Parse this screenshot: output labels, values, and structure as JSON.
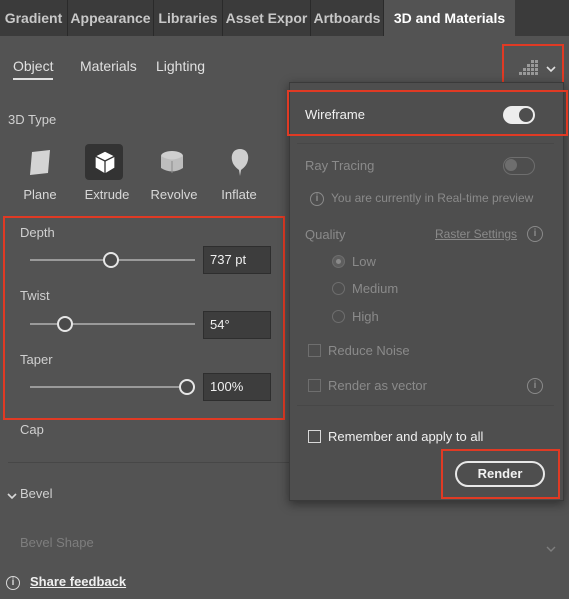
{
  "tabs": [
    "Gradient",
    "Appearance",
    "Libraries",
    "Asset Expor",
    "Artboards",
    "3D and Materials"
  ],
  "subtabs": [
    "Object",
    "Materials",
    "Lighting"
  ],
  "section_3d_type": "3D Type",
  "types": [
    "Plane",
    "Extrude",
    "Revolve",
    "Inflate"
  ],
  "depth": {
    "label": "Depth",
    "value": "737 pt",
    "level": 0.49
  },
  "twist": {
    "label": "Twist",
    "value": "54°",
    "level": 0.18
  },
  "taper": {
    "label": "Taper",
    "value": "100%",
    "level": 1.0
  },
  "cap_label": "Cap",
  "bevel_label": "Bevel",
  "bevel_shape_label": "Bevel Shape",
  "share_feedback": "Share feedback",
  "popover": {
    "wireframe": {
      "label": "Wireframe",
      "on": true
    },
    "ray_tracing": {
      "label": "Ray Tracing",
      "on": false
    },
    "realtime_note": "You are currently in Real-time preview",
    "quality_label": "Quality",
    "raster_settings": "Raster Settings",
    "quality_options": [
      "Low",
      "Medium",
      "High"
    ],
    "quality_selected": "Low",
    "reduce_noise": "Reduce Noise",
    "render_as_vector": "Render as vector",
    "remember": "Remember and apply to all",
    "render_button": "Render"
  },
  "colors": {
    "highlight": "#e03a24",
    "panel": "#535353",
    "tabbar": "#3b3b3b"
  }
}
